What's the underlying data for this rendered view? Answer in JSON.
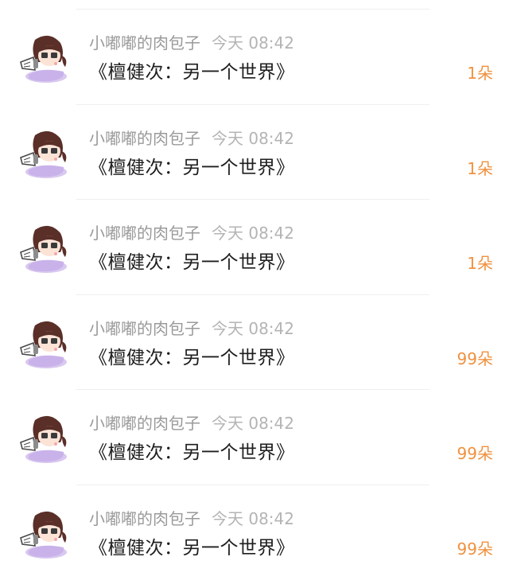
{
  "colors": {
    "username": "#9a9a9a",
    "timestamp": "#b4b4b4",
    "message": "#1e1e1e",
    "count": "#f0913f",
    "divider": "#efefef"
  },
  "avatar_icon": "girl-with-megaphone-avatar-icon",
  "items": [
    {
      "username": "小嘟嘟的肉包子",
      "time": "今天 08:42",
      "message": "《檀健次：另一个世界》",
      "count": "1朵"
    },
    {
      "username": "小嘟嘟的肉包子",
      "time": "今天 08:42",
      "message": "《檀健次：另一个世界》",
      "count": "1朵"
    },
    {
      "username": "小嘟嘟的肉包子",
      "time": "今天 08:42",
      "message": "《檀健次：另一个世界》",
      "count": "1朵"
    },
    {
      "username": "小嘟嘟的肉包子",
      "time": "今天 08:42",
      "message": "《檀健次：另一个世界》",
      "count": "99朵"
    },
    {
      "username": "小嘟嘟的肉包子",
      "time": "今天 08:42",
      "message": "《檀健次：另一个世界》",
      "count": "99朵"
    },
    {
      "username": "小嘟嘟的肉包子",
      "time": "今天 08:42",
      "message": "《檀健次：另一个世界》",
      "count": "99朵"
    }
  ]
}
